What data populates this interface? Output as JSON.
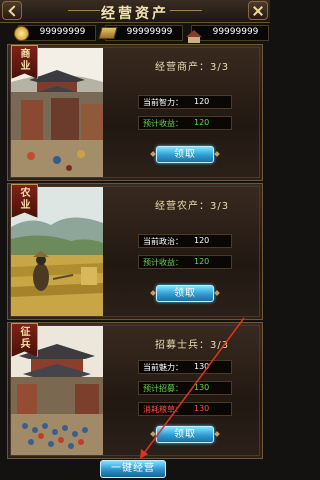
{
  "header": {
    "title": "经营资产"
  },
  "resources": [
    {
      "icon": "coin-icon",
      "value": "99999999"
    },
    {
      "icon": "grain-icon",
      "value": "99999999"
    },
    {
      "icon": "house-icon",
      "value": "99999999"
    }
  ],
  "cards": [
    {
      "ribbon": "商业",
      "title": "经营商产：3/3",
      "stats": [
        {
          "label": "当前智力：",
          "value": "120"
        },
        {
          "label": "预计收益：",
          "value": "120"
        }
      ],
      "button": "领取"
    },
    {
      "ribbon": "农业",
      "title": "经营农产：3/3",
      "stats": [
        {
          "label": "当前政治：",
          "value": "120"
        },
        {
          "label": "预计收益：",
          "value": "120"
        }
      ],
      "button": "领取"
    },
    {
      "ribbon": "征兵",
      "title": "招募士兵：3/3",
      "stats": [
        {
          "label": "当前魅力：",
          "value": "130"
        },
        {
          "label": "预计招募：",
          "value": "130"
        },
        {
          "label": "消耗粮草：",
          "value": "130"
        }
      ],
      "button": "领取"
    }
  ],
  "footer": {
    "one_key_button": "一键经营"
  }
}
